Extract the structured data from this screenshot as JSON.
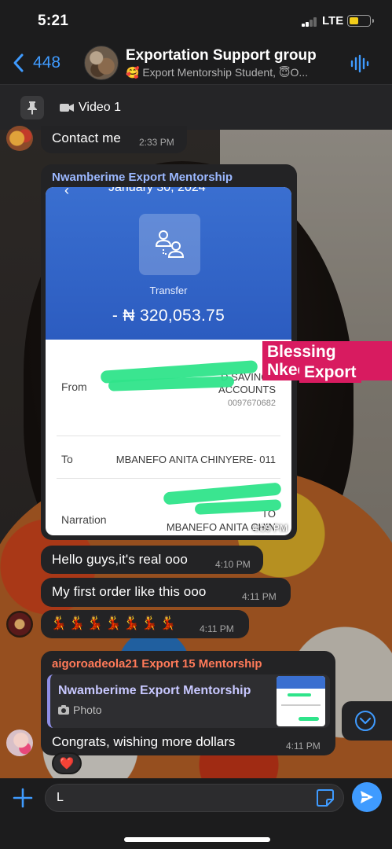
{
  "status": {
    "time": "5:21",
    "network": "LTE"
  },
  "header": {
    "back_count": "448",
    "title": "Exportation Support group",
    "subtitle": "🥰 Export Mentorship Student, 😇O..."
  },
  "pinned": {
    "label": "Video 1"
  },
  "messages": {
    "contact": {
      "text": "Contact me",
      "time": "2:33 PM"
    },
    "image": {
      "sender": "Nwamberime Export Mentorship",
      "time": "4:09 PM",
      "receipt": {
        "date": "January 30, 2024",
        "kind": "Transfer",
        "amount": "- ₦ 320,053.75",
        "from_label": "From",
        "from_value_1": "D SAVINGS",
        "from_value_2": "ACCOUNTS",
        "from_account": "0097670682",
        "to_label": "To",
        "to_value": "MBANEFO ANITA CHINYERE- 011",
        "narration_label": "Narration",
        "narration_value_1": "TO",
        "narration_value_2": "MBANEFO ANITA CHIN"
      },
      "overlay_line1": "Blessing Nkech",
      "overlay_line2": "Export"
    },
    "m1": {
      "text": "Hello guys,it's real ooo",
      "time": "4:10 PM"
    },
    "m2": {
      "text": "My first order like this ooo",
      "time": "4:11 PM"
    },
    "m3": {
      "text": "💃💃💃💃💃💃💃",
      "time": "4:11 PM"
    },
    "reply": {
      "sender": "aigoroadeola21 Export 15 Mentorship",
      "quoted_name": "Nwamberime Export Mentorship",
      "quoted_kind": "Photo",
      "text": "Congrats, wishing more dollars",
      "time": "4:11 PM",
      "reaction": "❤️"
    }
  },
  "input": {
    "value": "L"
  },
  "colors": {
    "accent": "#3f9bff",
    "bubble": "#232325",
    "reply_sender": "#ff7a59"
  }
}
